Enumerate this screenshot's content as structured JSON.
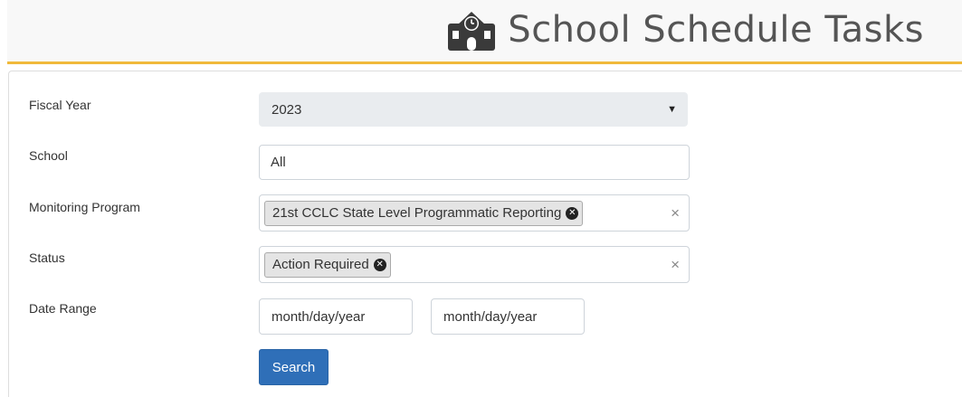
{
  "header": {
    "title": "School Schedule Tasks",
    "icon": "school-icon"
  },
  "form": {
    "fiscal_year": {
      "label": "Fiscal Year",
      "value": "2023"
    },
    "school": {
      "label": "School",
      "value": "All"
    },
    "monitoring_program": {
      "label": "Monitoring Program",
      "tags": [
        "21st CCLC State Level Programmatic Reporting"
      ]
    },
    "status": {
      "label": "Status",
      "tags": [
        "Action Required"
      ]
    },
    "date_range": {
      "label": "Date Range",
      "start_placeholder": "month/day/year",
      "end_placeholder": "month/day/year"
    },
    "search_label": "Search"
  },
  "colors": {
    "accent": "#f0b93a",
    "button": "#2f6fb8"
  }
}
